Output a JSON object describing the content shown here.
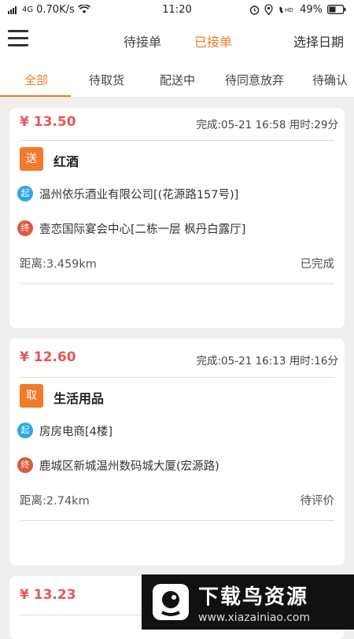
{
  "status_bar": {
    "signal": "4G",
    "speed": "0.70K/s",
    "time": "11:20",
    "battery": "49%"
  },
  "top_nav": {
    "tabs": [
      {
        "label": "待接单"
      },
      {
        "label": "已接单",
        "active": true
      }
    ],
    "date_select": "选择日期"
  },
  "filter_tabs": [
    {
      "label": "全部",
      "active": true
    },
    {
      "label": "待取货"
    },
    {
      "label": "配送中"
    },
    {
      "label": "待同意放弃"
    },
    {
      "label": "待确认"
    }
  ],
  "orders": [
    {
      "price": "¥ 13.50",
      "meta": "完成:05-21 16:58 用时:29分",
      "type_badge": "送",
      "item_name": "红酒",
      "start_badge": "起",
      "start_addr": "温州依乐酒业有限公司[(花源路157号)]",
      "end_badge": "终",
      "end_addr": "壹恋国际宴会中心[二栋一层 枫丹白露厅]",
      "distance": "距离:3.459km",
      "status": "已完成"
    },
    {
      "price": "¥ 12.60",
      "meta": "完成:05-21 16:13 用时:16分",
      "type_badge": "取",
      "item_name": "生活用品",
      "start_badge": "起",
      "start_addr": "房房电商[4楼]",
      "end_badge": "终",
      "end_addr": "鹿城区新城温州数码城大厦(宏源路)",
      "distance": "距离:2.74km",
      "status": "待评价"
    },
    {
      "price": "¥ 13.23"
    }
  ],
  "watermark": {
    "title": "下载鸟资源",
    "url": "www.xiazainiao.com"
  },
  "colors": {
    "accent": "#f07b2c",
    "price": "#e8555a",
    "start": "#2fa6ea",
    "end": "#dd5a3e"
  }
}
